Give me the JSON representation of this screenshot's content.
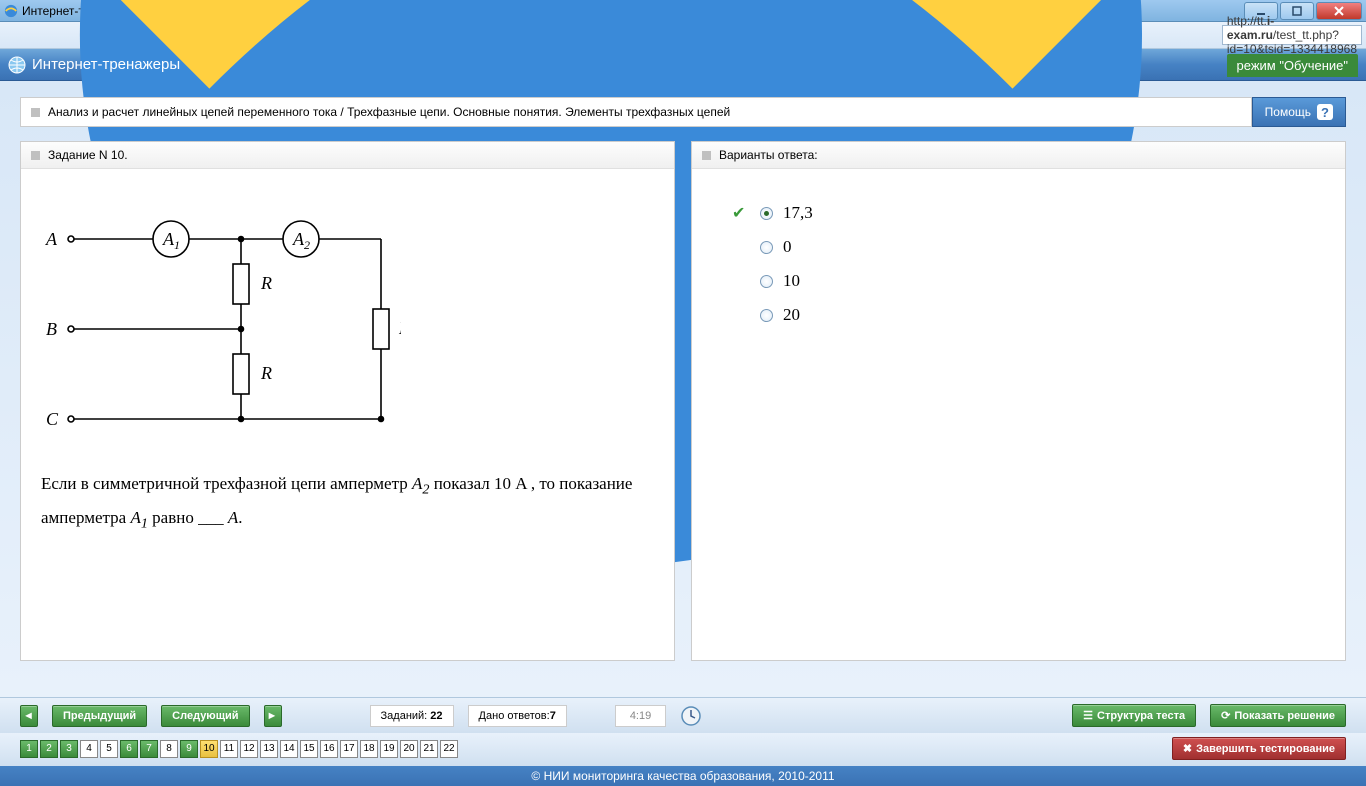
{
  "window": {
    "title": "Интернет-тренажеры - Windows Internet Explorer"
  },
  "url": {
    "prefix": "http://tt.",
    "domain": "i-exam.ru",
    "path": "/test_tt.php?id=10&tsid=1334418968"
  },
  "app": {
    "title": "Интернет-тренажеры",
    "mode": "режим \"Обучение\""
  },
  "breadcrumb": "Анализ и расчет линейных цепей переменного тока / Трехфазные цепи. Основные понятия. Элементы трехфазных цепей",
  "help": "Помощь",
  "task": {
    "header": "Задание N 10.",
    "text1": "Если в симметричной трехфазной цепи амперметр ",
    "a2": "A",
    "a2sub": "2",
    "text2": "  показал ",
    "val": "10 A",
    "text3": " , то показание амперметра ",
    "a1": "A",
    "a1sub": "1",
    "text4": "  равно ___ ",
    "unit": "A",
    "text5": "."
  },
  "answers": {
    "header": "Варианты ответа:",
    "items": [
      {
        "label": "17,3",
        "selected": true,
        "correct": true
      },
      {
        "label": "0",
        "selected": false,
        "correct": false
      },
      {
        "label": "10",
        "selected": false,
        "correct": false
      },
      {
        "label": "20",
        "selected": false,
        "correct": false
      }
    ]
  },
  "nav": {
    "prev": "Предыдущий",
    "next": "Следующий",
    "tasks_label": "Заданий:",
    "tasks_count": "22",
    "answers_label": "Дано ответов:",
    "answers_count": "7",
    "timer": "4:19",
    "structure": "Структура теста",
    "show_solution": "Показать решение",
    "finish": "Завершить тестирование"
  },
  "pager": {
    "done": [
      1,
      2,
      3,
      6,
      7,
      9
    ],
    "current": 10,
    "total": 22
  },
  "footer": "© НИИ мониторинга качества образования, 2010-2011",
  "diagram": {
    "A": "A",
    "B": "B",
    "C": "C",
    "A1": "A",
    "A1s": "1",
    "A2": "A",
    "A2s": "2",
    "R": "R"
  }
}
